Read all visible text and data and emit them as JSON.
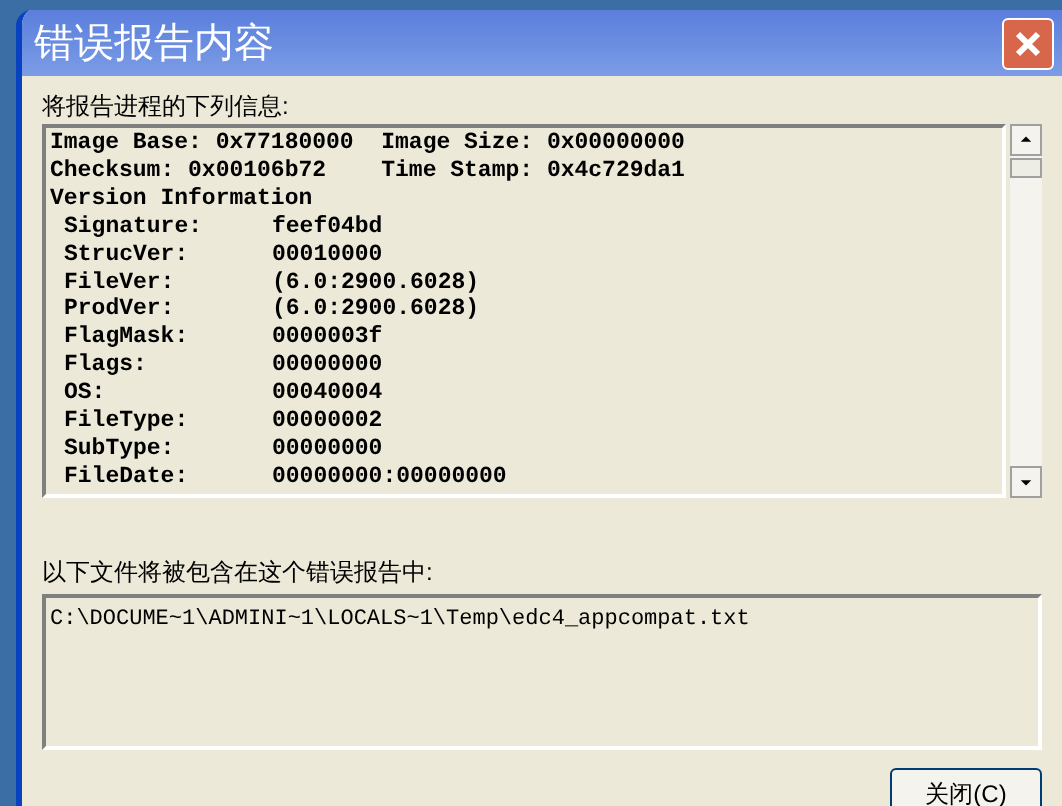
{
  "window": {
    "title": "错误报告内容"
  },
  "info_label": "将报告进程的下列信息:",
  "info_lines": [
    {
      "kind": "text",
      "text": "Image Base: 0x77180000  Image Size: 0x00000000"
    },
    {
      "kind": "text",
      "text": "Checksum: 0x00106b72    Time Stamp: 0x4c729da1"
    },
    {
      "kind": "text",
      "text": "Version Information"
    },
    {
      "kind": "field",
      "label": "Signature:",
      "value": "feef04bd"
    },
    {
      "kind": "field",
      "label": "StrucVer:",
      "value": "00010000"
    },
    {
      "kind": "field",
      "label": "FileVer:",
      "value": "(6.0:2900.6028)"
    },
    {
      "kind": "field",
      "label": "ProdVer:",
      "value": "(6.0:2900.6028)"
    },
    {
      "kind": "field",
      "label": "FlagMask:",
      "value": "0000003f"
    },
    {
      "kind": "field",
      "label": "Flags:",
      "value": "00000000"
    },
    {
      "kind": "field",
      "label": "OS:",
      "value": "00040004"
    },
    {
      "kind": "field",
      "label": "FileType:",
      "value": "00000002"
    },
    {
      "kind": "field",
      "label": "SubType:",
      "value": "00000000"
    },
    {
      "kind": "field",
      "label": "FileDate:",
      "value": "00000000:00000000"
    }
  ],
  "files_label": "以下文件将被包含在这个错误报告中:",
  "files": [
    "C:\\DOCUME~1\\ADMINI~1\\LOCALS~1\\Temp\\edc4_appcompat.txt"
  ],
  "close_button": "关闭(C)"
}
